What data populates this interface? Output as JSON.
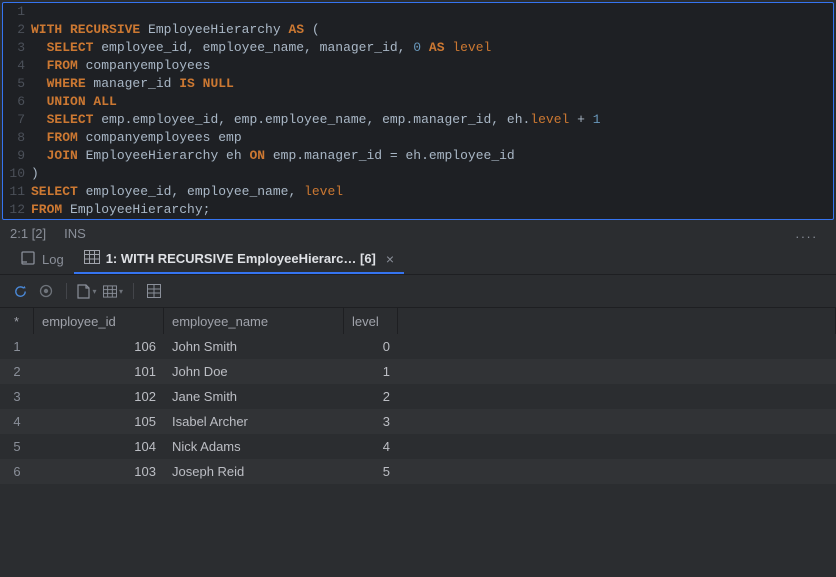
{
  "editor": {
    "lines": [
      {
        "n": "1",
        "fragments": [
          {
            "t": "",
            "c": ""
          }
        ]
      },
      {
        "n": "2",
        "fragments": [
          {
            "t": "WITH RECURSIVE",
            "c": "kw"
          },
          {
            "t": " EmployeeHierarchy ",
            "c": "ident"
          },
          {
            "t": "AS",
            "c": "kw"
          },
          {
            "t": " (",
            "c": "ident"
          }
        ]
      },
      {
        "n": "3",
        "fragments": [
          {
            "t": "  ",
            "c": ""
          },
          {
            "t": "SELECT",
            "c": "kw"
          },
          {
            "t": " employee_id, employee_name, manager_id, ",
            "c": "ident"
          },
          {
            "t": "0",
            "c": "num"
          },
          {
            "t": " ",
            "c": ""
          },
          {
            "t": "AS",
            "c": "kw"
          },
          {
            "t": " ",
            "c": ""
          },
          {
            "t": "level",
            "c": "kw2"
          }
        ]
      },
      {
        "n": "4",
        "fragments": [
          {
            "t": "  ",
            "c": ""
          },
          {
            "t": "FROM",
            "c": "kw"
          },
          {
            "t": " companyemployees",
            "c": "ident"
          }
        ]
      },
      {
        "n": "5",
        "fragments": [
          {
            "t": "  ",
            "c": ""
          },
          {
            "t": "WHERE",
            "c": "kw"
          },
          {
            "t": " manager_id ",
            "c": "ident"
          },
          {
            "t": "IS NULL",
            "c": "kw"
          }
        ]
      },
      {
        "n": "6",
        "fragments": [
          {
            "t": "  ",
            "c": ""
          },
          {
            "t": "UNION ALL",
            "c": "kw"
          }
        ]
      },
      {
        "n": "7",
        "fragments": [
          {
            "t": "  ",
            "c": ""
          },
          {
            "t": "SELECT",
            "c": "kw"
          },
          {
            "t": " emp.employee_id, emp.employee_name, emp.manager_id, eh.",
            "c": "ident"
          },
          {
            "t": "level",
            "c": "kw2"
          },
          {
            "t": " + ",
            "c": "ident"
          },
          {
            "t": "1",
            "c": "num"
          }
        ]
      },
      {
        "n": "8",
        "fragments": [
          {
            "t": "  ",
            "c": ""
          },
          {
            "t": "FROM",
            "c": "kw"
          },
          {
            "t": " companyemployees emp",
            "c": "ident"
          }
        ]
      },
      {
        "n": "9",
        "fragments": [
          {
            "t": "  ",
            "c": ""
          },
          {
            "t": "JOIN",
            "c": "kw"
          },
          {
            "t": " EmployeeHierarchy eh ",
            "c": "ident"
          },
          {
            "t": "ON",
            "c": "kw"
          },
          {
            "t": " emp.manager_id = eh.employee_id",
            "c": "ident"
          }
        ]
      },
      {
        "n": "10",
        "fragments": [
          {
            "t": ")",
            "c": "ident"
          }
        ]
      },
      {
        "n": "11",
        "fragments": [
          {
            "t": "SELECT",
            "c": "kw"
          },
          {
            "t": " employee_id, employee_name, ",
            "c": "ident"
          },
          {
            "t": "level",
            "c": "kw2"
          }
        ]
      },
      {
        "n": "12",
        "fragments": [
          {
            "t": "FROM",
            "c": "kw"
          },
          {
            "t": " EmployeeHierarchy;",
            "c": "ident"
          }
        ]
      }
    ]
  },
  "status": {
    "cursor": "2:1 [2]",
    "mode": "INS"
  },
  "tabs": {
    "log_label": "Log",
    "active_label": "1: WITH RECURSIVE EmployeeHierarc… [6]"
  },
  "table": {
    "index_header": "*",
    "columns": [
      "employee_id",
      "employee_name",
      "level"
    ],
    "rows": [
      {
        "n": "1",
        "employee_id": "106",
        "employee_name": "John Smith",
        "level": "0"
      },
      {
        "n": "2",
        "employee_id": "101",
        "employee_name": "John Doe",
        "level": "1"
      },
      {
        "n": "3",
        "employee_id": "102",
        "employee_name": "Jane Smith",
        "level": "2"
      },
      {
        "n": "4",
        "employee_id": "105",
        "employee_name": "Isabel Archer",
        "level": "3"
      },
      {
        "n": "5",
        "employee_id": "104",
        "employee_name": "Nick Adams",
        "level": "4"
      },
      {
        "n": "6",
        "employee_id": "103",
        "employee_name": "Joseph Reid",
        "level": "5"
      }
    ]
  }
}
